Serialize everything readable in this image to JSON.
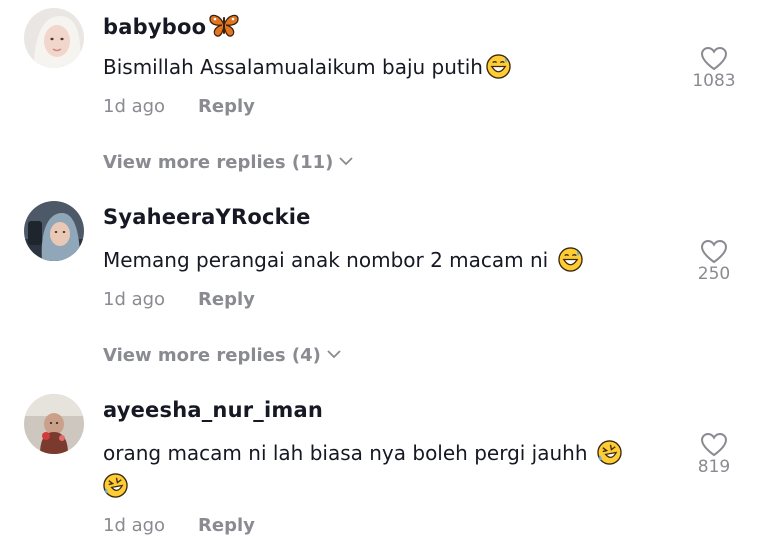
{
  "comments": [
    {
      "username": "babyboo",
      "username_badge_icon": "butterfly-emoji",
      "text": "Bismillah Assalamualaikum baju putih",
      "text_emojis": [
        "grinning-sweat-emoji"
      ],
      "time": "1d ago",
      "reply_label": "Reply",
      "likes": "1083",
      "view_more": "View more replies (11)"
    },
    {
      "username": "SyaheeraYRockie",
      "text": "Memang perangai anak nombor 2 macam ni",
      "text_emojis": [
        "grinning-sweat-emoji"
      ],
      "time": "1d ago",
      "reply_label": "Reply",
      "likes": "250",
      "view_more": "View more replies (4)"
    },
    {
      "username": "ayeesha_nur_iman",
      "text": "orang macam ni lah biasa nya boleh pergi jauhh",
      "text_emojis": [
        "rolling-laughing-emoji",
        "rolling-laughing-emoji"
      ],
      "time": "1d ago",
      "reply_label": "Reply",
      "likes": "819"
    }
  ],
  "colors": {
    "primary_text": "#161823",
    "secondary_text": "#8a8b91",
    "heart_outline": "#8a8b91",
    "emoji_yellow": "#ffcc33"
  },
  "icons": {
    "like": "heart-outline-icon",
    "expand": "chevron-down-icon"
  }
}
